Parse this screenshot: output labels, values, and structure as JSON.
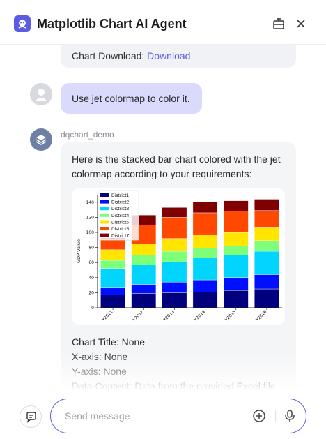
{
  "header": {
    "title": "Matplotlib Chart AI Agent",
    "icons": {
      "logo": "agent-logo-icon",
      "dock": "dock-panel-icon",
      "close": "close-icon"
    }
  },
  "messages": {
    "previous": {
      "prefix": "Chart Download: ",
      "link": "Download"
    },
    "user": {
      "text": "Use jet colormap to color it."
    },
    "agent": {
      "name": "dqchart_demo",
      "intro": "Here is the stacked bar chart colored with the jet colormap according to your requirements:",
      "meta": [
        "Chart Title: None",
        "X-axis: None",
        "Y-axis: None",
        "Data Content: Data from the provided Excel file"
      ]
    }
  },
  "input": {
    "placeholder": "Send message"
  },
  "colors": {
    "accent": "#5b5ce2",
    "user_bubble": "#d9dafc",
    "agent_bubble": "#f4f5f7"
  },
  "chart_data": {
    "type": "bar",
    "stacked": true,
    "colormap": "jet",
    "title": "",
    "xlabel": "",
    "ylabel": "GDP Value",
    "ylim": [
      0,
      150
    ],
    "yticks": [
      0,
      20,
      40,
      60,
      80,
      100,
      120,
      140
    ],
    "grid": false,
    "legend_position": "top-left",
    "categories": [
      "Y2011",
      "Y2012",
      "Y2013",
      "Y2014",
      "Y2015",
      "Y2016"
    ],
    "series": [
      {
        "name": "District1",
        "color": "#00007f",
        "values": [
          17,
          19,
          20,
          21,
          23,
          25
        ]
      },
      {
        "name": "District2",
        "color": "#0010ff",
        "values": [
          10,
          12,
          14,
          16,
          17,
          19
        ]
      },
      {
        "name": "District3",
        "color": "#00d4ff",
        "values": [
          25,
          26,
          27,
          29,
          30,
          31
        ]
      },
      {
        "name": "District4",
        "color": "#7dff7a",
        "values": [
          11,
          13,
          14,
          13,
          12,
          14
        ]
      },
      {
        "name": "District5",
        "color": "#ffe500",
        "values": [
          14,
          15,
          17,
          18,
          18,
          18
        ]
      },
      {
        "name": "District6",
        "color": "#ff4800",
        "values": [
          13,
          25,
          28,
          29,
          28,
          22
        ]
      },
      {
        "name": "District7",
        "color": "#7f0000",
        "values": [
          3,
          13,
          13,
          14,
          14,
          15
        ]
      }
    ]
  }
}
